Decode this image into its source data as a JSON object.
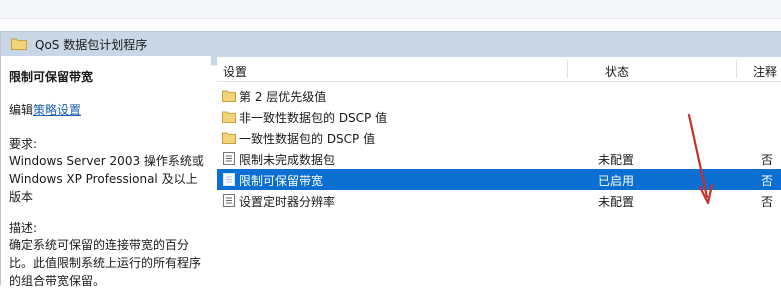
{
  "window": {
    "header_title": "QoS 数据包计划程序"
  },
  "left_pane": {
    "title": "限制可保留带宽",
    "edit_prefix": "编辑",
    "edit_link": "策略设置",
    "requirements_label": "要求:",
    "requirements_text": "Windows Server 2003 操作系统或 Windows XP Professional 及以上版本",
    "description_label": "描述:",
    "description_text": "确定系统可保留的连接带宽的百分比。此值限制系统上运行的所有程序的组合带宽保留。"
  },
  "columns": {
    "setting": "设置",
    "state": "状态",
    "note": "注释"
  },
  "rows": [
    {
      "icon": "folder-icon",
      "name": "第 2 层优先级值",
      "state": "",
      "note": ""
    },
    {
      "icon": "folder-icon",
      "name": "非一致性数据包的 DSCP 值",
      "state": "",
      "note": ""
    },
    {
      "icon": "folder-icon",
      "name": "一致性数据包的 DSCP 值",
      "state": "",
      "note": ""
    },
    {
      "icon": "policy-setting-icon",
      "name": "限制未完成数据包",
      "state": "未配置",
      "note": "否"
    },
    {
      "icon": "policy-setting-icon",
      "name": "限制可保留带宽",
      "state": "已启用",
      "note": "否"
    },
    {
      "icon": "policy-setting-icon",
      "name": "设置定时器分辨率",
      "state": "未配置",
      "note": "否"
    }
  ],
  "selected_row": 4,
  "colors": {
    "header_bar": "#c9d6e6",
    "selection": "#0a6fd0",
    "link": "#1b5fb8",
    "arrow": "#c8302a",
    "folder": "#e9c25a"
  }
}
